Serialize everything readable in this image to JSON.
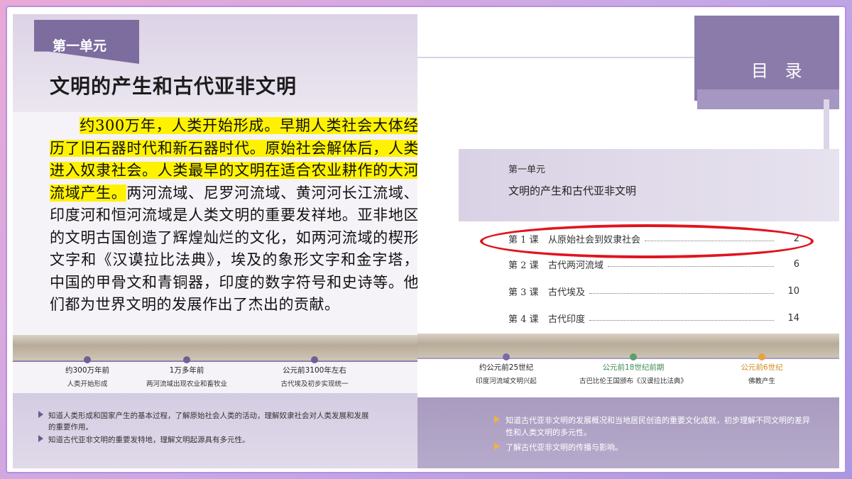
{
  "left": {
    "unit_tab": "第一单元",
    "unit_title": "文明的产生和古代亚非文明",
    "paragraph_highlighted": "约300万年，人类开始形成。早期人类社会大体经历了旧石器时代和新石器时代。原始社会解体后，人类进入奴隶社会。人类最早的文明在适合农业耕作的大河流域产生。",
    "paragraph_rest": "两河流域、尼罗河流域、黄河河长江流域、印度河和恒河流域是人类文明的重要发祥地。亚非地区的文明古国创造了辉煌灿烂的文化，如两河流域的楔形文字和《汉谟拉比法典》，埃及的象形文字和金字塔，中国的甲骨文和青铜器，印度的数字符号和史诗等。他们都为世界文明的发展作出了杰出的贡献。",
    "timeline": [
      {
        "date": "约300万年前",
        "event": "人类开始形成"
      },
      {
        "date": "1万多年前",
        "event": "两河流域出现农业和畜牧业"
      },
      {
        "date": "公元前3100年左右",
        "event": "古代埃及初步实现统一"
      }
    ],
    "goals": [
      "知道人类形成和国家产生的基本过程，了解原始社会人类的活动，理解奴隶社会对人类发展和发展的重要作用。",
      "知道古代亚非文明的重要发特地，理解文明起源具有多元性。"
    ]
  },
  "right": {
    "toc_title": "目 录",
    "unit_label": "第一单元",
    "unit_title": "文明的产生和古代亚非文明",
    "lessons": [
      {
        "num": "第 1 课",
        "name": "从原始社会到奴隶社会",
        "page": "2"
      },
      {
        "num": "第 2 课",
        "name": "古代两河流域",
        "page": "6"
      },
      {
        "num": "第 3 课",
        "name": "古代埃及",
        "page": "10"
      },
      {
        "num": "第 4 课",
        "name": "古代印度",
        "page": "14"
      }
    ],
    "timeline": [
      {
        "date": "约公元前25世纪",
        "event": "印度河流域文明兴起",
        "color": "#7b6aa8"
      },
      {
        "date": "公元前18世纪前期",
        "event": "古巴比伦王国颁布《汉谟拉比法典》",
        "color": "#5aa06a"
      },
      {
        "date": "公元前6世纪",
        "event": "佛教产生",
        "color": "#e6a33a"
      }
    ],
    "goals": [
      "知道古代亚非文明的发展概况和当地居民创造的重要文化成就，初步理解不同文明的差异性和人类文明的多元性。",
      "了解古代亚非文明的传播与影响。"
    ]
  }
}
